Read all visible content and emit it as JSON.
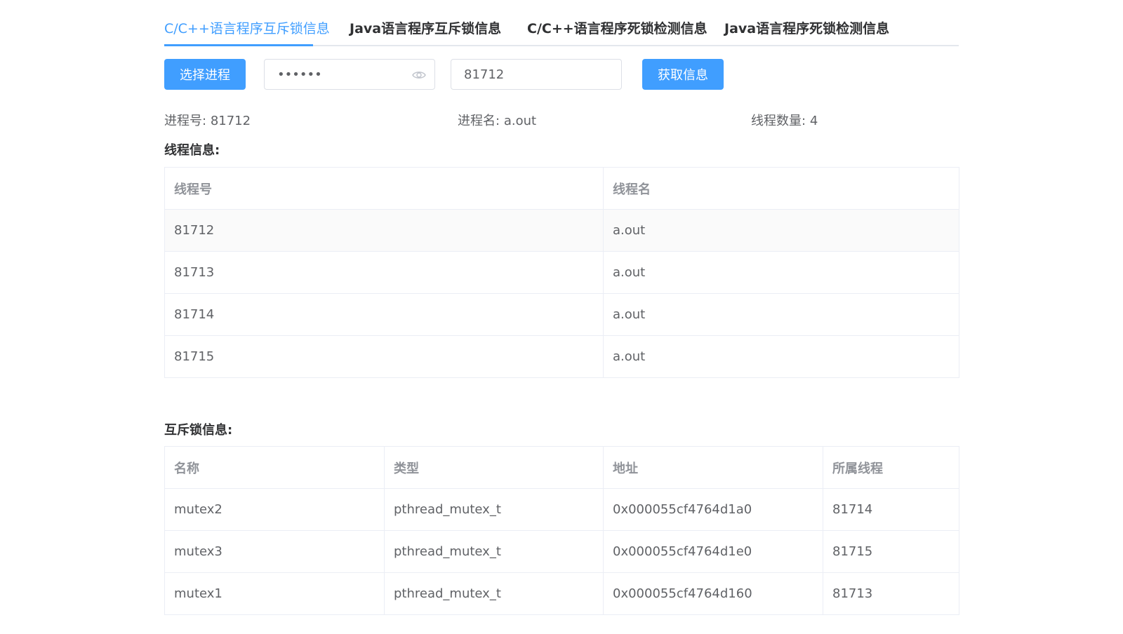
{
  "tabs": [
    {
      "label": "C/C++语言程序互斥锁信息",
      "active": true
    },
    {
      "label": "Java语言程序互斥锁信息",
      "active": false
    },
    {
      "label": "C/C++语言程序死锁检测信息",
      "active": false
    },
    {
      "label": "Java语言程序死锁检测信息",
      "active": false
    }
  ],
  "toolbar": {
    "select_process_label": "选择进程",
    "password_value": "••••••",
    "pid_value": "81712",
    "get_info_label": "获取信息"
  },
  "info": {
    "pid_label": "进程号:",
    "pid_value": "81712",
    "pname_label": "进程名:",
    "pname_value": "a.out",
    "thread_count_label": "线程数量:",
    "thread_count_value": "4"
  },
  "threads": {
    "title": "线程信息:",
    "columns": [
      "线程号",
      "线程名"
    ],
    "rows": [
      [
        "81712",
        "a.out"
      ],
      [
        "81713",
        "a.out"
      ],
      [
        "81714",
        "a.out"
      ],
      [
        "81715",
        "a.out"
      ]
    ]
  },
  "mutexes": {
    "title": "互斥锁信息:",
    "columns": [
      "名称",
      "类型",
      "地址",
      "所属线程"
    ],
    "rows": [
      [
        "mutex2",
        "pthread_mutex_t",
        "0x000055cf4764d1a0",
        "81714"
      ],
      [
        "mutex3",
        "pthread_mutex_t",
        "0x000055cf4764d1e0",
        "81715"
      ],
      [
        "mutex1",
        "pthread_mutex_t",
        "0x000055cf4764d160",
        "81713"
      ]
    ]
  },
  "colors": {
    "primary": "#409eff",
    "text": "#303133",
    "muted": "#909399",
    "border": "#ebeef5"
  }
}
